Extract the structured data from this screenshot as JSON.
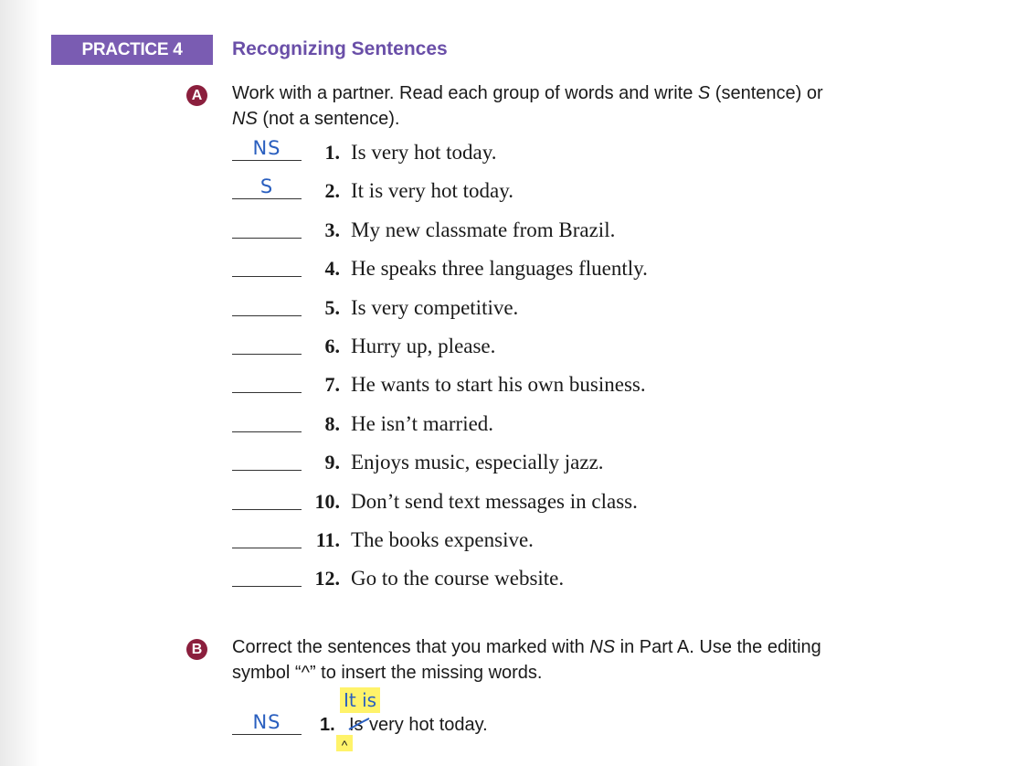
{
  "practice": {
    "label": "PRACTICE 4",
    "title": "Recognizing Sentences",
    "tag_color": "#7a5cb2",
    "title_color": "#6a4fa8"
  },
  "partA": {
    "badge": "A",
    "instruction_1": "Work with a partner. Read each group of words and write ",
    "instruction_em1": "S",
    "instruction_2": " (sentence) or",
    "instruction_em2": "NS",
    "instruction_3": " (not a sentence).",
    "items": [
      {
        "num": "1.",
        "text": "Is very hot today.",
        "answer": "NS"
      },
      {
        "num": "2.",
        "text": "It is very hot today.",
        "answer": "S"
      },
      {
        "num": "3.",
        "text": "My new classmate from Brazil.",
        "answer": ""
      },
      {
        "num": "4.",
        "text": "He speaks three languages fluently.",
        "answer": ""
      },
      {
        "num": "5.",
        "text": "Is very competitive.",
        "answer": ""
      },
      {
        "num": "6.",
        "text": "Hurry up, please.",
        "answer": ""
      },
      {
        "num": "7.",
        "text": "He wants to start his own business.",
        "answer": ""
      },
      {
        "num": "8.",
        "text": "He isn’t married.",
        "answer": ""
      },
      {
        "num": "9.",
        "text": "Enjoys music, especially jazz.",
        "answer": ""
      },
      {
        "num": "10.",
        "text": "Don’t send text messages in class.",
        "answer": ""
      },
      {
        "num": "11.",
        "text": "The books expensive.",
        "answer": ""
      },
      {
        "num": "12.",
        "text": "Go to the course website.",
        "answer": ""
      }
    ]
  },
  "partB": {
    "badge": "B",
    "instruction_1": "Correct the sentences that you marked with ",
    "instruction_em1": "NS",
    "instruction_2": " in Part A. Use the editing",
    "instruction_3": "symbol “^” to insert the missing words.",
    "example": {
      "answer": "NS",
      "num": "1.",
      "struck": "Is",
      "rest": "very hot today.",
      "insertion": "It is",
      "caret": "^"
    }
  },
  "colors": {
    "badge": "#8b1f3d",
    "handwriting": "#2a5fbf",
    "highlight": "#fff36a"
  }
}
